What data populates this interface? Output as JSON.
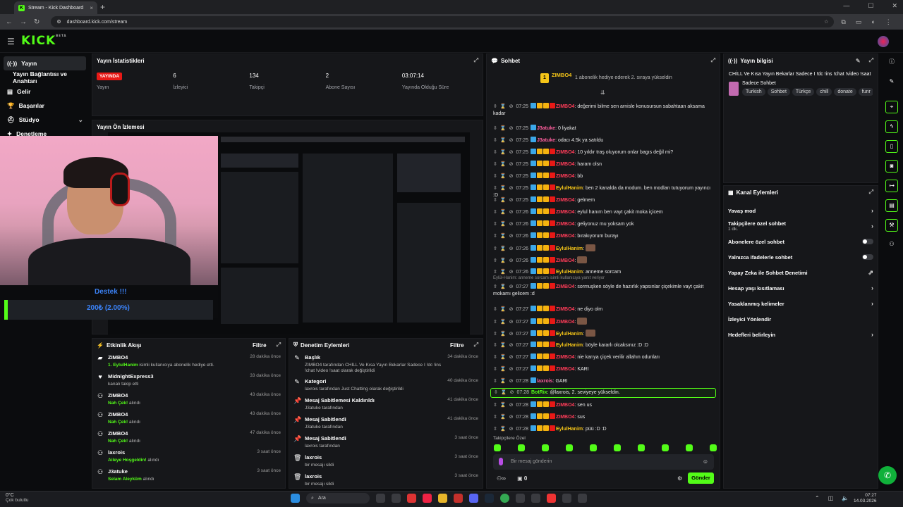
{
  "browser": {
    "tab_title": "Stream - Kick Dashboard",
    "url": "dashboard.kick.com/stream"
  },
  "app": {
    "logo": "KICK",
    "logo_badge": "BETA"
  },
  "sidebar": {
    "items": [
      {
        "label": "Yayın",
        "icon": "broadcast-icon"
      },
      {
        "label": "Yayın Bağlantısı ve Anahtarı",
        "icon": "key-icon"
      },
      {
        "label": "Gelir",
        "icon": "money-icon"
      },
      {
        "label": "Başarılar",
        "icon": "trophy-icon"
      },
      {
        "label": "Stüdyo",
        "icon": "studio-icon"
      },
      {
        "label": "Denetleme",
        "icon": "shield-icon"
      }
    ]
  },
  "stats": {
    "title": "Yayın İstatistikleri",
    "items": [
      {
        "value": "YAYINDA",
        "label": "Yayın"
      },
      {
        "value": "6",
        "label": "İzleyici"
      },
      {
        "value": "134",
        "label": "Takipçi"
      },
      {
        "value": "2",
        "label": "Abone Sayısı"
      },
      {
        "value": "03:07:14",
        "label": "Yayında Olduğu Süre"
      }
    ]
  },
  "preview": {
    "title": "Yayın Ön İzlemesi"
  },
  "overlay": {
    "donate_title": "Destek !!!",
    "donate_amount": "200₺ (2.00%)"
  },
  "events": {
    "title": "Etkinlik Akışı",
    "filter": "Filtre",
    "items": [
      {
        "name": "ZIMBO4",
        "detail_hl": "1. EylulHanim",
        "detail": " isimli kullanıcıya abonelik hediye etti.",
        "time": "28 dakika önce"
      },
      {
        "name": "MidnightExpress3",
        "detail_hl": "",
        "detail": "kanalı takip etti",
        "time": "33 dakika önce"
      },
      {
        "name": "ZIMBO4",
        "detail_hl": "Nah Çek!",
        "detail": " alındı",
        "time": "43 dakika önce"
      },
      {
        "name": "ZIMBO4",
        "detail_hl": "Nah Çek!",
        "detail": " alındı",
        "time": "43 dakika önce"
      },
      {
        "name": "ZIMBO4",
        "detail_hl": "Nah Çek!",
        "detail": " alındı",
        "time": "47 dakika önce"
      },
      {
        "name": "laxrois",
        "detail_hl": "Aileye Hoşgeldin!",
        "detail": " alındı",
        "time": "3 saat önce"
      },
      {
        "name": "J3atuke",
        "detail_hl": "Selam Aleyküm",
        "detail": " alındı",
        "time": "3 saat önce"
      }
    ]
  },
  "modlog": {
    "title": "Denetim Eylemleri",
    "filter": "Filtre",
    "items": [
      {
        "name": "Başlık",
        "detail": "ZIMBO4 tarafından CHİLL Ve Kısa Yayın Bekarlar Sadece I !dc !ins !chat !video !saat olarak değiştirildi",
        "time": "34 dakika önce"
      },
      {
        "name": "Kategori",
        "detail": "laxrois tarafından Just Chatting olarak değiştirildi",
        "time": "40 dakika önce"
      },
      {
        "name": "Mesaj Sabitlemesi Kaldırıldı",
        "detail": "J3atuke tarafından",
        "time": "41 dakika önce"
      },
      {
        "name": "Mesaj Sabitlendi",
        "detail": "J3atuke tarafından",
        "time": "41 dakika önce"
      },
      {
        "name": "Mesaj Sabitlendi",
        "detail": "laxrois tarafından",
        "time": "3 saat önce"
      },
      {
        "name": "laxrois",
        "detail": "bir mesajı sildi",
        "time": "3 saat önce"
      },
      {
        "name": "laxrois",
        "detail": "bir mesajı sildi",
        "time": "3 saat önce"
      }
    ]
  },
  "chat": {
    "title": "Sohbet",
    "top_gifter": "ZIMBO4",
    "top_gifter_msg": "1 abonelik hediye ederek 2. sıraya yükseldin",
    "messages": [
      {
        "time": "07:25",
        "user": "ZIMBO4",
        "text": ": değerimi bilme sen arnisle konusursun sabahtaan aksama kadar",
        "cls": "u1"
      },
      {
        "time": "07:25",
        "user": "J3atuke",
        "text": ": 0 liyakat",
        "cls": "u4"
      },
      {
        "time": "07:25",
        "user": "J3atuke",
        "text": ": odacı 4.5k ya satıldu",
        "cls": "u4"
      },
      {
        "time": "07:25",
        "user": "ZIMBO4",
        "text": ": 10 yıldır traş oluyorum onlar bagıs değil mi?",
        "cls": "u1"
      },
      {
        "time": "07:25",
        "user": "ZIMBO4",
        "text": ": haram olsn",
        "cls": "u1"
      },
      {
        "time": "07:25",
        "user": "ZIMBO4",
        "text": ": bb",
        "cls": "u1"
      },
      {
        "time": "07:25",
        "user": "EylulHanim",
        "text": ": ben 2 kanalda da modum. ben modları tutuyorum yayıncı :D",
        "cls": "u2"
      },
      {
        "time": "07:25",
        "user": "ZIMBO4",
        "text": ": gelmem",
        "cls": "u1"
      },
      {
        "time": "07:26",
        "user": "ZIMBO4",
        "text": ": eylul hanım ben vayt çakit moka içicem",
        "cls": "u1"
      },
      {
        "time": "07:26",
        "user": "ZIMBO4",
        "text": ": geliyonuz mu yoksam yok",
        "cls": "u1"
      },
      {
        "time": "07:26",
        "user": "ZIMBO4",
        "text": ": bırakıyorum burayı",
        "cls": "u1"
      },
      {
        "time": "07:26",
        "user": "EylulHanim",
        "text": ":",
        "cls": "u2"
      },
      {
        "time": "07:26",
        "user": "ZIMBO4",
        "text": ":",
        "cls": "u1"
      },
      {
        "time": "07:26",
        "user": "EylulHanim",
        "text": ": anneme sorcam",
        "cls": "u2"
      },
      {
        "time": "07:27",
        "user": "ZIMBO4",
        "text": ": sormuşken söyle de hazırlık yapsınlar çiçekimle vayt çakit mokamı gelicem :d",
        "cls": "u1"
      },
      {
        "time": "07:27",
        "user": "ZIMBO4",
        "text": ": ne diyo olm",
        "cls": "u1"
      },
      {
        "time": "07:27",
        "user": "ZIMBO4",
        "text": ":",
        "cls": "u1"
      },
      {
        "time": "07:27",
        "user": "EylulHanim",
        "text": ":",
        "cls": "u2"
      },
      {
        "time": "07:27",
        "user": "EylulHanim",
        "text": ": böyle kararlı olcaksınız :D :D",
        "cls": "u2"
      },
      {
        "time": "07:27",
        "user": "ZIMBO4",
        "text": ": nie karıya çiçek verilir allahın odunları",
        "cls": "u1"
      },
      {
        "time": "07:27",
        "user": "ZIMBO4",
        "text": ": KARI",
        "cls": "u1"
      },
      {
        "time": "07:28",
        "user": "laxrois",
        "text": ": GARI",
        "cls": "u4"
      },
      {
        "time": "07:28",
        "user": "BotRix",
        "text": ": @laxrois, 2. seviyeye yükseldin.",
        "cls": "u3"
      },
      {
        "time": "07:28",
        "user": "ZIMBO4",
        "text": ": sen us",
        "cls": "u1"
      },
      {
        "time": "07:28",
        "user": "ZIMBO4",
        "text": ": sus",
        "cls": "u1"
      },
      {
        "time": "07:28",
        "user": "EylulHanim",
        "text": ": püü :D :D",
        "cls": "u2"
      }
    ],
    "reply_context": "Eylül-Hanim: anneme sorcam isimli kullanıcıya yanıt veriyor",
    "followers_only": "Takipçilere Özel",
    "placeholder": "Bir mesaj gönderin",
    "send": "Gönder",
    "counter": "0"
  },
  "info": {
    "title": "Yayın bilgisi",
    "stream_title": "CHİLL Ve Kısa Yayın Bekarlar Sadece I !dc !ins !chat !video !saat",
    "category": "Sadece Sohbet",
    "tags": [
      "Turkish",
      "Sohbet",
      "Türkçe",
      "chill",
      "donate",
      "funr"
    ]
  },
  "actions": {
    "title": "Kanal Eylemleri",
    "items": [
      {
        "label": "Yavaş mod",
        "sub": "",
        "kind": "chevron"
      },
      {
        "label": "Takipçilere özel sohbet",
        "sub": "1 dk.",
        "kind": "chevron"
      },
      {
        "label": "Abonelere özel sohbet",
        "sub": "",
        "kind": "toggle"
      },
      {
        "label": "Yalnızca ifadelerle sohbet",
        "sub": "",
        "kind": "toggle"
      },
      {
        "label": "Yapay Zeka ile Sohbet Denetimi",
        "sub": "",
        "kind": "external"
      },
      {
        "label": "Hesap yaşı kısıtlaması",
        "sub": "",
        "kind": "chevron"
      },
      {
        "label": "Yasaklanmış kelimeler",
        "sub": "",
        "kind": "chevron"
      },
      {
        "label": "İzleyici Yönlendir",
        "sub": "",
        "kind": "none"
      },
      {
        "label": "Hedefleri belirleyin",
        "sub": "",
        "kind": "chevron"
      }
    ]
  },
  "taskbar": {
    "weather_temp": "0°C",
    "weather_desc": "Çok bulutlu",
    "search": "Ara",
    "time": "07:27",
    "date": "14.03.2026"
  },
  "colors": {
    "accent": "#53fc18",
    "live": "#e91916",
    "panel": "#16171a"
  }
}
